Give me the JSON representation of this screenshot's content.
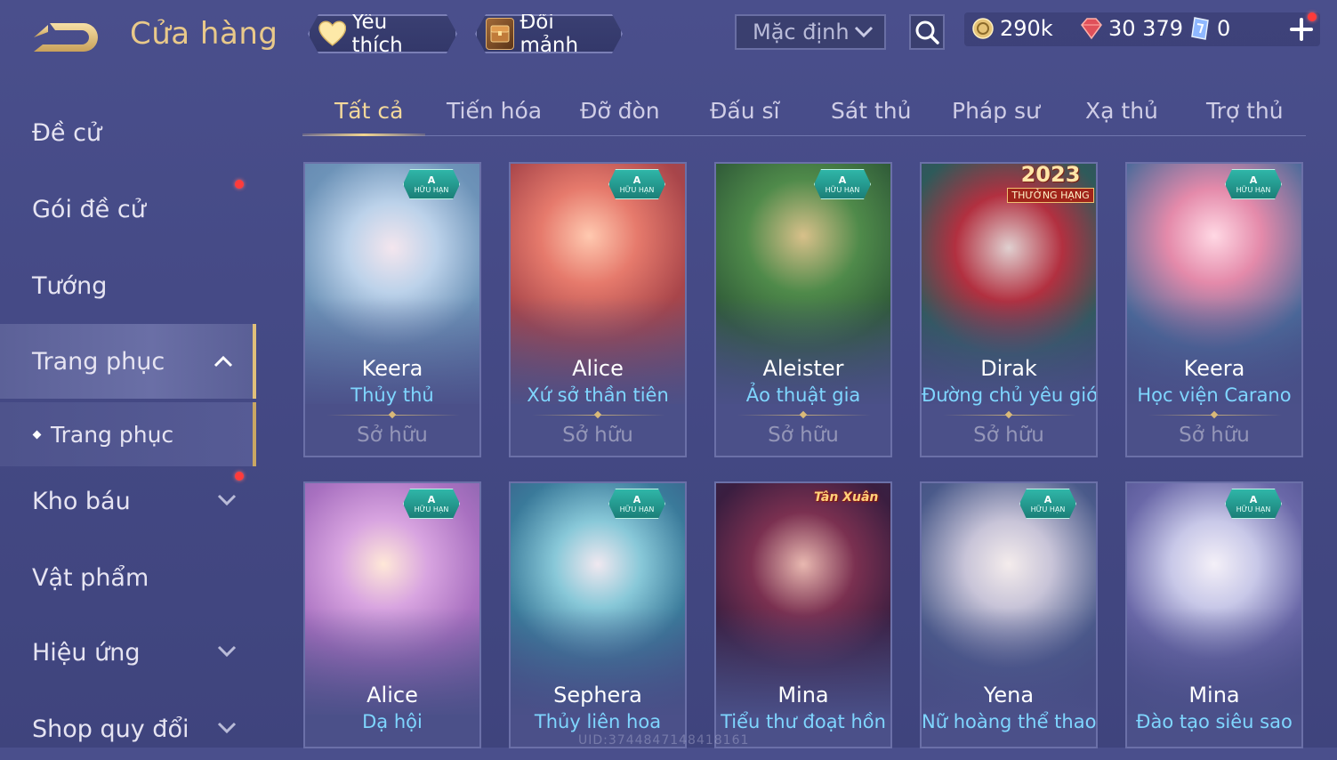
{
  "topbar": {
    "title": "Cửa hàng",
    "favorite_label": "Yêu thích",
    "exchange_label": "Đổi mảnh",
    "sort_selected": "Mặc định",
    "gold_amount": "290k",
    "ruby_amount": "30 379",
    "ticket_amount": "0"
  },
  "sidebar": {
    "items": [
      {
        "label": "Đề cử"
      },
      {
        "label": "Gói đề cử"
      },
      {
        "label": "Tướng"
      },
      {
        "label": "Trang phục"
      },
      {
        "label": "Trang phục"
      },
      {
        "label": "Kho báu"
      },
      {
        "label": "Vật phẩm"
      },
      {
        "label": "Hiệu ứng"
      },
      {
        "label": "Shop quy đổi"
      }
    ]
  },
  "tabs": [
    {
      "label": "Tất cả"
    },
    {
      "label": "Tiến hóa"
    },
    {
      "label": "Đỡ đòn"
    },
    {
      "label": "Đấu sĩ"
    },
    {
      "label": "Sát thủ"
    },
    {
      "label": "Pháp sư"
    },
    {
      "label": "Xạ thủ"
    },
    {
      "label": "Trợ thủ"
    }
  ],
  "badge": {
    "grade": "A",
    "tag": "HỮU HẠN"
  },
  "badge_2023": {
    "year": "2023",
    "ribbon": "THƯỞNG HẠNG"
  },
  "badge_tet": {
    "text": "Tân Xuân"
  },
  "cards_row1": [
    {
      "hero": "Keera",
      "skin": "Thủy thủ",
      "status": "Sở hữu"
    },
    {
      "hero": "Alice",
      "skin": "Xứ sở thần tiên",
      "status": "Sở hữu"
    },
    {
      "hero": "Aleister",
      "skin": "Ảo thuật gia",
      "status": "Sở hữu"
    },
    {
      "hero": "Dirak",
      "skin": "Đường chủ yêu giới",
      "status": "Sở hữu"
    },
    {
      "hero": "Keera",
      "skin": "Học viện Carano",
      "status": "Sở hữu"
    }
  ],
  "cards_row2": [
    {
      "hero": "Alice",
      "skin": "Dạ hội"
    },
    {
      "hero": "Sephera",
      "skin": "Thủy liên hoa"
    },
    {
      "hero": "Mina",
      "skin": "Tiểu thư đoạt hồn"
    },
    {
      "hero": "Yena",
      "skin": "Nữ hoàng thể thao"
    },
    {
      "hero": "Mina",
      "skin": "Đào tạo siêu sao"
    }
  ],
  "footer": {
    "uid": "UID:3744847148418161"
  },
  "colors": {
    "accent_gold": "#e9c98a",
    "skin_name_blue": "#7fd6ff",
    "notification_red": "#ff3b3b",
    "badge_teal": "#2fb6a8"
  },
  "icons": [
    "back-arrow-icon",
    "heart-icon",
    "shard-chest-icon",
    "chevron-down-icon",
    "search-icon",
    "gold-coin-icon",
    "ruby-icon",
    "ticket-icon",
    "plus-icon",
    "chevron-up-icon"
  ]
}
